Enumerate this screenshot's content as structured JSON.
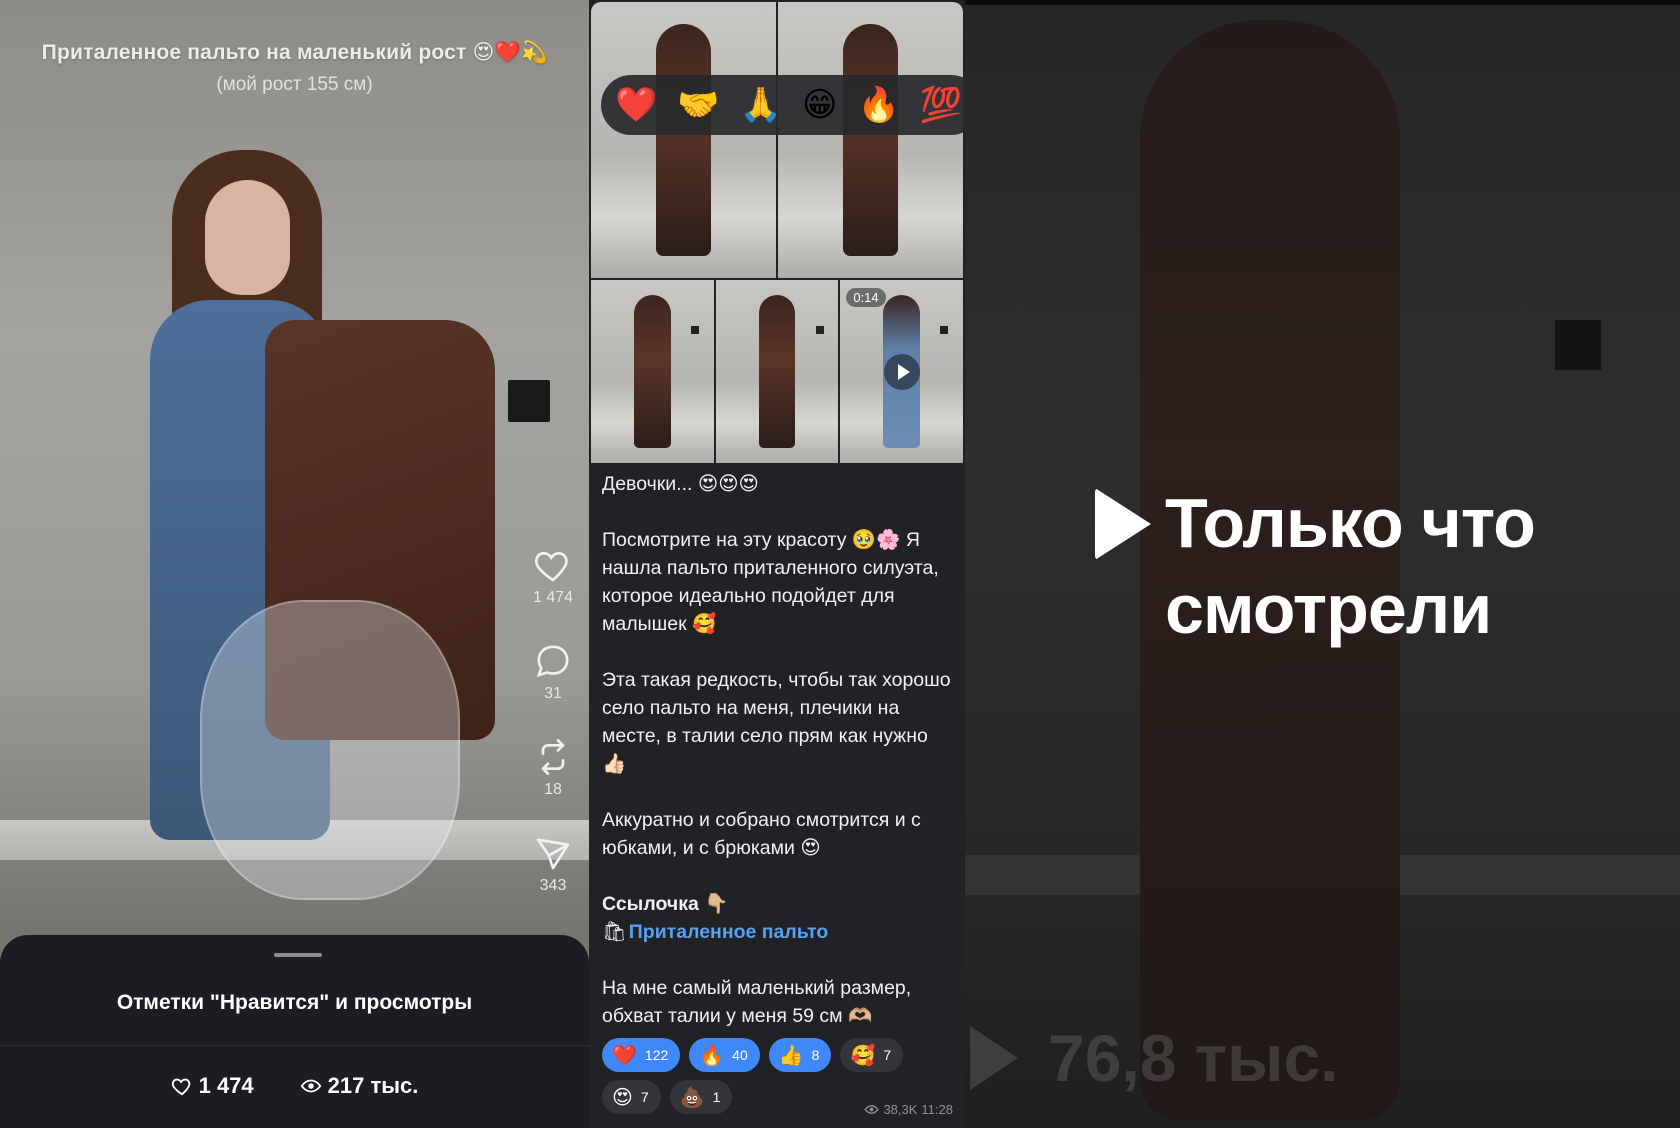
{
  "left_post": {
    "title": "Приталенное пальто на маленький рост 😍❤️💫",
    "subtitle": "(мой рост 155 см)",
    "actions": [
      {
        "name": "like",
        "icon": "heart-outline-icon",
        "count": "1 474"
      },
      {
        "name": "comment",
        "icon": "comment-bubble-icon",
        "count": "31"
      },
      {
        "name": "repost",
        "icon": "repost-icon",
        "count": "18"
      },
      {
        "name": "share",
        "icon": "send-icon",
        "count": "343"
      }
    ],
    "sheet": {
      "title": "Отметки \"Нравится\" и просмотры",
      "likes": "1 474",
      "views": "217 тыс."
    }
  },
  "channel_post": {
    "reaction_picker": [
      "❤️",
      "🤝",
      "🙏",
      "😁",
      "🔥",
      "💯",
      "😢"
    ],
    "video_duration": "0:14",
    "greeting": "Девочки... 😍😍😍",
    "para1": "Посмотрите на эту красоту 🥹🌸 Я нашла пальто приталенного силуэта, которое идеально подойдет для малышек 🥰",
    "para2": "Эта такая редкость, чтобы так хорошо село пальто на меня, плечики на месте, в талии село прям как нужно 👍🏻",
    "para3": "Аккуратно и собрано смотрится и с юбками, и с брюками 😍",
    "link_heading": "Ссылочка 👇🏼",
    "link_icon": "🛍",
    "link_text": "Приталенное пальто",
    "para4": "На мне самый маленький размер, обхват талии у меня 59 см 🫶🏼",
    "reactions": [
      {
        "emoji": "❤️",
        "count": "122",
        "active": true
      },
      {
        "emoji": "🔥",
        "count": "40",
        "active": true
      },
      {
        "emoji": "👍",
        "count": "8",
        "active": true
      },
      {
        "emoji": "🥰",
        "count": "7",
        "active": false
      },
      {
        "emoji": "😍",
        "count": "7",
        "active": false
      },
      {
        "emoji": "💩",
        "count": "1",
        "active": false
      }
    ],
    "views": "38,3K",
    "time": "11:28"
  },
  "right_video": {
    "overlay_line1": "Только что",
    "overlay_line2": "смотрели",
    "views_ghost": "76,8 тыс."
  },
  "colors": {
    "link": "#5aa0f0",
    "reaction_active": "#3e88f7",
    "panel_dark": "#212226"
  }
}
